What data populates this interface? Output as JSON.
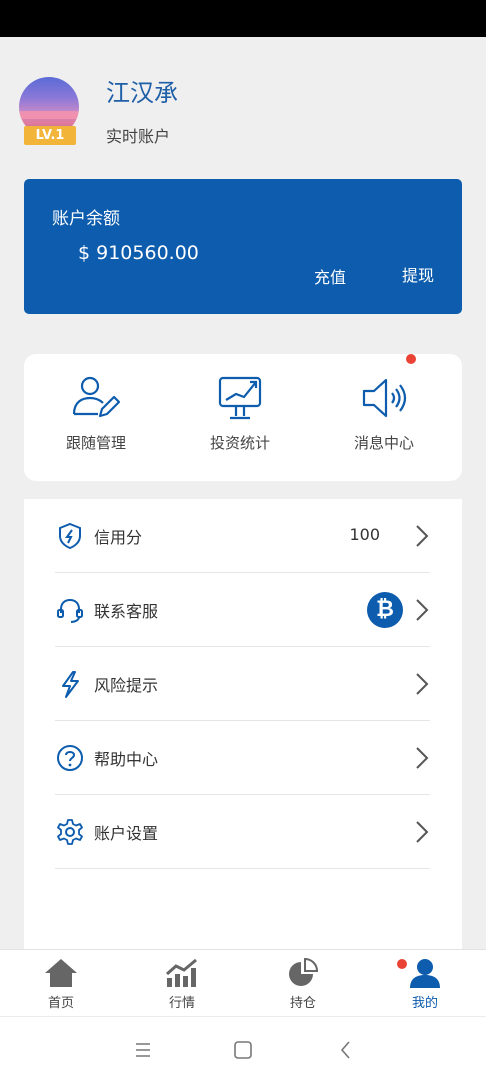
{
  "profile": {
    "name": "江汉承",
    "account_type": "实时账户",
    "level": "LV.1"
  },
  "balance": {
    "label": "账户余额",
    "amount": "$ 910560.00",
    "recharge": "充值",
    "withdraw": "提现"
  },
  "quick_actions": [
    {
      "label": "跟随管理",
      "icon": "user-edit-icon"
    },
    {
      "label": "投资统计",
      "icon": "monitor-chart-icon"
    },
    {
      "label": "消息中心",
      "icon": "speaker-icon",
      "has_notification": true
    }
  ],
  "menu": [
    {
      "label": "信用分",
      "value": "100",
      "icon": "shield-bolt-icon"
    },
    {
      "label": "联系客服",
      "badge": "₿",
      "icon": "headset-icon"
    },
    {
      "label": "风险提示",
      "icon": "lightning-icon"
    },
    {
      "label": "帮助中心",
      "icon": "question-icon"
    },
    {
      "label": "账户设置",
      "icon": "gear-icon"
    }
  ],
  "tabs": [
    {
      "label": "首页",
      "icon": "home-icon"
    },
    {
      "label": "行情",
      "icon": "market-chart-icon"
    },
    {
      "label": "持仓",
      "icon": "pie-chart-icon"
    },
    {
      "label": "我的",
      "icon": "person-icon",
      "active": true,
      "has_notification": true
    }
  ],
  "colors": {
    "primary": "#0d5cad",
    "badge": "#f3b43a",
    "notification": "#ea4335",
    "background": "#efefef"
  }
}
